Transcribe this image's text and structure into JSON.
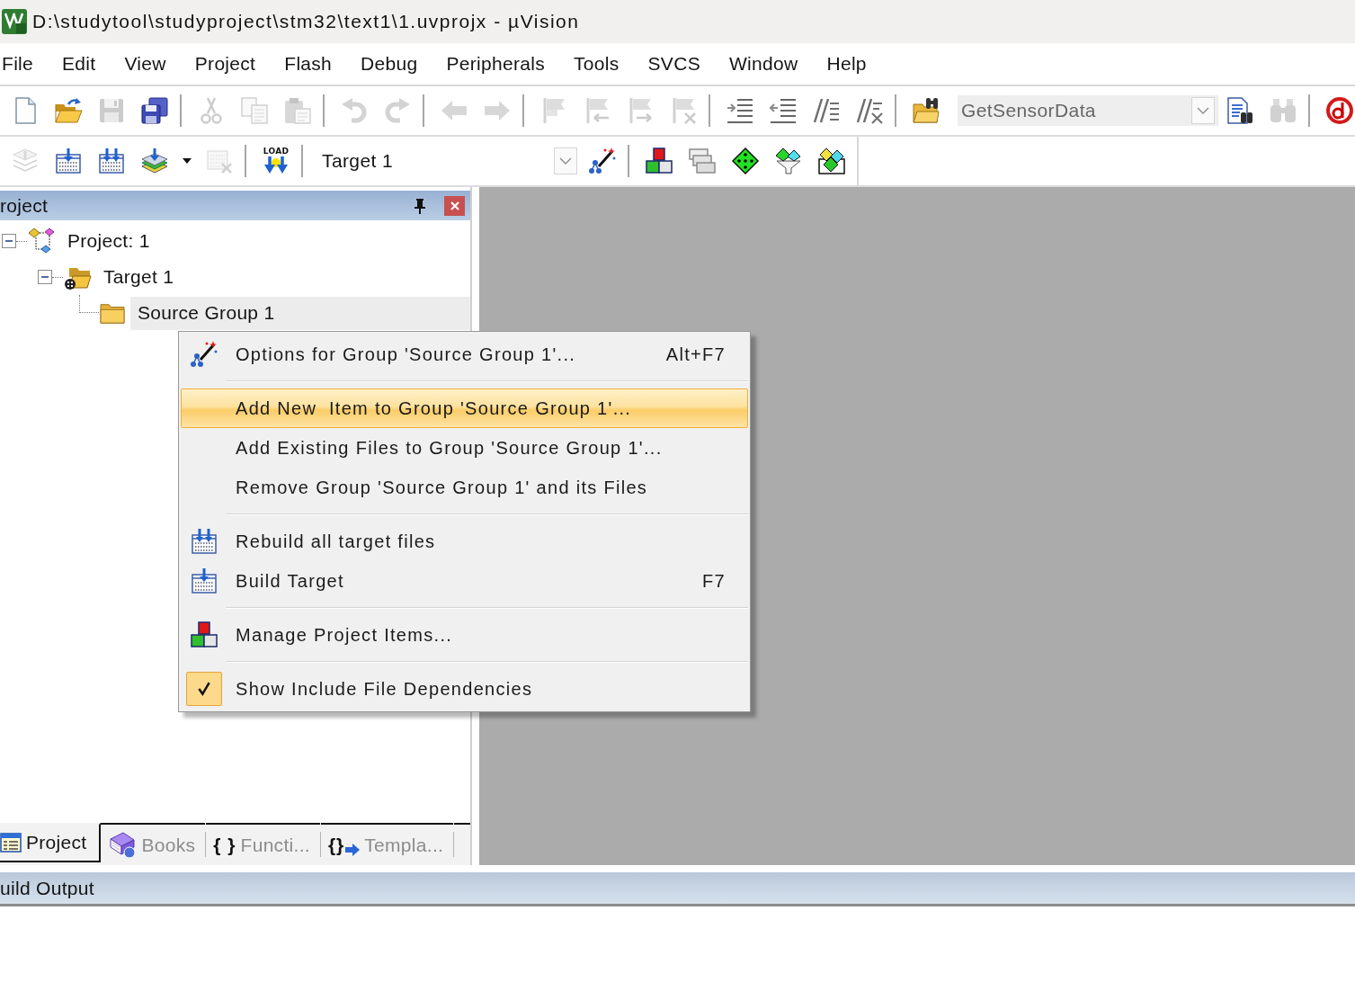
{
  "window": {
    "title": "D:\\studytool\\studyproject\\stm32\\text1\\1.uvprojx - µVision"
  },
  "menu_bar": [
    "File",
    "Edit",
    "View",
    "Project",
    "Flash",
    "Debug",
    "Peripherals",
    "Tools",
    "SVCS",
    "Window",
    "Help"
  ],
  "toolbar_1": {
    "items": [
      {
        "kind": "newfile",
        "disabled": false
      },
      {
        "kind": "open",
        "disabled": false
      },
      {
        "kind": "save",
        "disabled": true
      },
      {
        "kind": "saveall",
        "disabled": false
      },
      {
        "kind": "separator"
      },
      {
        "kind": "cut",
        "disabled": true
      },
      {
        "kind": "copy",
        "disabled": true
      },
      {
        "kind": "paste",
        "disabled": true
      },
      {
        "kind": "separator"
      },
      {
        "kind": "undo",
        "disabled": true
      },
      {
        "kind": "redo",
        "disabled": true
      },
      {
        "kind": "separator"
      },
      {
        "kind": "back",
        "disabled": true
      },
      {
        "kind": "forward",
        "disabled": true
      },
      {
        "kind": "separator"
      },
      {
        "kind": "flag",
        "disabled": true
      },
      {
        "kind": "flagprev",
        "disabled": true
      },
      {
        "kind": "flagnext",
        "disabled": true
      },
      {
        "kind": "flagclear",
        "disabled": true
      },
      {
        "kind": "separator"
      },
      {
        "kind": "indent",
        "disabled": false
      },
      {
        "kind": "unindent",
        "disabled": false
      },
      {
        "kind": "comment",
        "disabled": false
      },
      {
        "kind": "uncomment",
        "disabled": false
      },
      {
        "kind": "separator"
      },
      {
        "kind": "findfiles",
        "disabled": false
      },
      {
        "kind": "combo",
        "value": "GetSensorData"
      },
      {
        "kind": "finddoc",
        "disabled": false
      },
      {
        "kind": "tool",
        "disabled": true
      },
      {
        "kind": "separator"
      },
      {
        "kind": "debug",
        "disabled": false
      }
    ]
  },
  "toolbar_2": {
    "items": [
      {
        "kind": "translate",
        "disabled": true
      },
      {
        "kind": "build",
        "disabled": false
      },
      {
        "kind": "rebuild",
        "disabled": false
      },
      {
        "kind": "batch",
        "disabled": false
      },
      {
        "kind": "caret"
      },
      {
        "kind": "stop",
        "disabled": true
      },
      {
        "kind": "separator"
      },
      {
        "kind": "load",
        "label": "LOAD",
        "disabled": false
      },
      {
        "kind": "separator"
      },
      {
        "kind": "combo",
        "value": "Target 1"
      },
      {
        "kind": "options",
        "disabled": false
      },
      {
        "kind": "separator"
      },
      {
        "kind": "manage",
        "disabled": false
      },
      {
        "kind": "windows",
        "disabled": false
      },
      {
        "kind": "diamond",
        "disabled": false
      },
      {
        "kind": "funnel",
        "disabled": false
      },
      {
        "kind": "diamonds",
        "disabled": false
      }
    ]
  },
  "project_panel": {
    "title": "roject",
    "tree": [
      {
        "kind": "project",
        "label": "Project: 1",
        "expanded": true,
        "selected": false,
        "children": [
          {
            "kind": "target",
            "label": "Target 1",
            "expanded": true,
            "selected": false,
            "children": [
              {
                "kind": "group",
                "label": "Source Group 1",
                "selected": true
              }
            ]
          }
        ]
      }
    ],
    "tabs": [
      {
        "kind": "project",
        "label": "Project",
        "selected": true
      },
      {
        "kind": "books",
        "label": "Books",
        "selected": false
      },
      {
        "kind": "functions",
        "symbol": "{ }",
        "label": "Functi...",
        "selected": false
      },
      {
        "kind": "templates",
        "symbol": "{}",
        "label": "Templa...",
        "selected": false
      }
    ]
  },
  "build_output": {
    "title": "uild Output"
  },
  "context_menu": {
    "groups": [
      [
        {
          "kind": "options",
          "label": "Options for Group 'Source Group 1'...",
          "shortcut": "Alt+F7",
          "selected": false
        }
      ],
      [
        {
          "kind": "plain",
          "label": "Add New  Item to Group 'Source Group 1'...",
          "selected": true
        },
        {
          "kind": "plain",
          "label": "Add Existing Files to Group 'Source Group 1'...",
          "selected": false
        },
        {
          "kind": "plain",
          "label": "Remove Group 'Source Group 1' and its Files",
          "selected": false
        }
      ],
      [
        {
          "kind": "rebuild",
          "label": "Rebuild all target files",
          "selected": false
        },
        {
          "kind": "build",
          "label": "Build Target",
          "shortcut": "F7",
          "selected": false
        }
      ],
      [
        {
          "kind": "manage",
          "label": "Manage Project Items...",
          "selected": false
        }
      ],
      [
        {
          "kind": "toggle",
          "label": "Show Include File Dependencies",
          "checked": true,
          "selected": false
        }
      ]
    ]
  }
}
